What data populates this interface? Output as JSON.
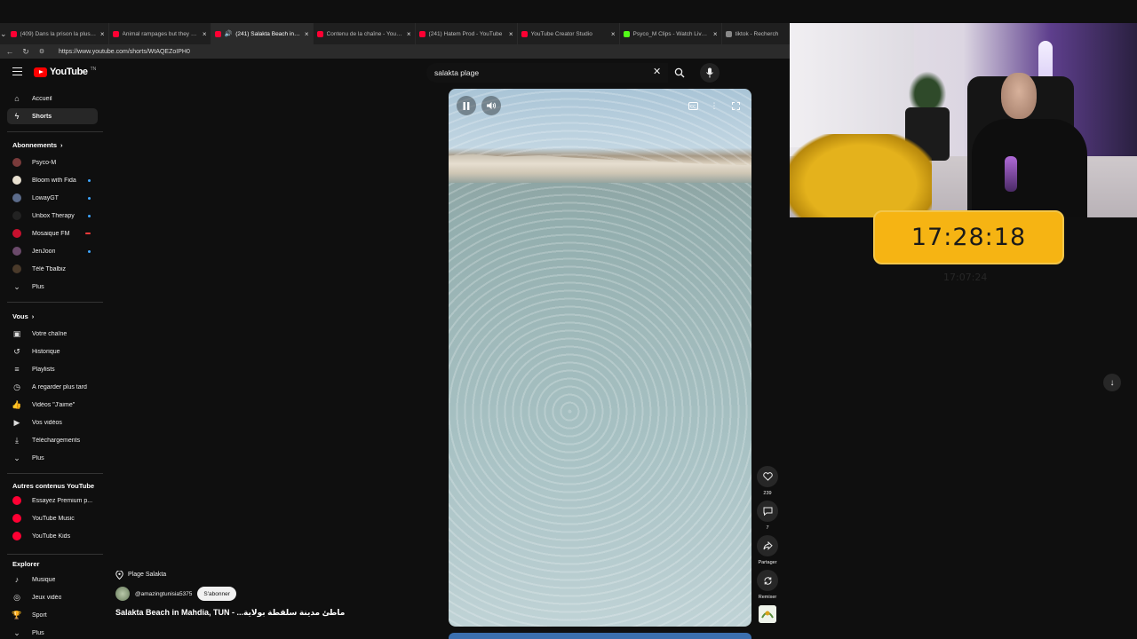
{
  "browser": {
    "tabs": [
      {
        "title": "(409) Dans la prison la plus surp",
        "color": "#ff0033",
        "active": false
      },
      {
        "title": "Animal rampages but they get i",
        "color": "#ff0033",
        "active": false
      },
      {
        "title": "(241) Salakta Beach in Mahd",
        "color": "#ff0033",
        "active": true
      },
      {
        "title": "Contenu de la chaîne - YouTube",
        "color": "#ff0033",
        "active": false
      },
      {
        "title": "(241) Hatem Prod - YouTube",
        "color": "#ff0033",
        "active": false
      },
      {
        "title": "YouTube Creator Studio",
        "color": "#ff0033",
        "active": false
      },
      {
        "title": "Psyco_M Clips - Watch Live on K",
        "color": "#53fc18",
        "active": false
      },
      {
        "title": "tiktok - Recherch",
        "color": "#888888",
        "active": false
      }
    ],
    "url": "https://www.youtube.com/shorts/WtAQEZoIPH0"
  },
  "header": {
    "logo_text": "YouTube",
    "logo_sup": "TN",
    "search_value": "salakta plage"
  },
  "sidebar": {
    "main": [
      {
        "label": "Accueil",
        "icon": "⌂"
      },
      {
        "label": "Shorts",
        "icon": "ϟ"
      }
    ],
    "subscriptions_title": "Abonnements",
    "subscriptions": [
      {
        "label": "Psyco-M",
        "color": "#7a3b3b",
        "dot": ""
      },
      {
        "label": "Bloom with Fida",
        "color": "#e8e0d0",
        "dot": "blue"
      },
      {
        "label": "LowayGT",
        "color": "#5b6b8a",
        "dot": "blue"
      },
      {
        "label": "Unbox Therapy",
        "color": "#222222",
        "dot": "blue"
      },
      {
        "label": "Mosaique FM",
        "color": "#c8102e",
        "dot": "red"
      },
      {
        "label": "JenJoon",
        "color": "#6b4a6b",
        "dot": "blue"
      },
      {
        "label": "Télé Tbalbiz",
        "color": "#4a3a2a",
        "dot": ""
      }
    ],
    "subscriptions_more": "Plus",
    "you_title": "Vous",
    "you": [
      {
        "label": "Votre chaîne",
        "icon": "▣"
      },
      {
        "label": "Historique",
        "icon": "↺"
      },
      {
        "label": "Playlists",
        "icon": "≡"
      },
      {
        "label": "À regarder plus tard",
        "icon": "◷"
      },
      {
        "label": "Vidéos \"J'aime\"",
        "icon": "👍"
      },
      {
        "label": "Vos vidéos",
        "icon": "▶"
      },
      {
        "label": "Téléchargements",
        "icon": "⤓"
      }
    ],
    "you_more": "Plus",
    "other_title": "Autres contenus YouTube",
    "other": [
      {
        "label": "Essayez Premium p...",
        "color": "#ff0033"
      },
      {
        "label": "YouTube Music",
        "color": "#ff0033"
      },
      {
        "label": "YouTube Kids",
        "color": "#ff0033"
      }
    ],
    "explore_title": "Explorer",
    "explore": [
      {
        "label": "Musique",
        "icon": "♪"
      },
      {
        "label": "Jeux vidéo",
        "icon": "◎"
      },
      {
        "label": "Sport",
        "icon": "🏆"
      }
    ],
    "explore_more": "Plus"
  },
  "video": {
    "location": "Plage Salakta",
    "channel": "@amazingtunisia5375",
    "subscribe_label": "S'abonner",
    "title": "Salakta Beach in Mahdia, TUN  - ...ماطئ مدينة سلقطة بولاية"
  },
  "actions": {
    "likes": "239",
    "comments": "7",
    "share": "Partager",
    "remix": "Remixer"
  },
  "overlay": {
    "clock": "17:28:18",
    "clock_ghost": "17:07:24"
  }
}
